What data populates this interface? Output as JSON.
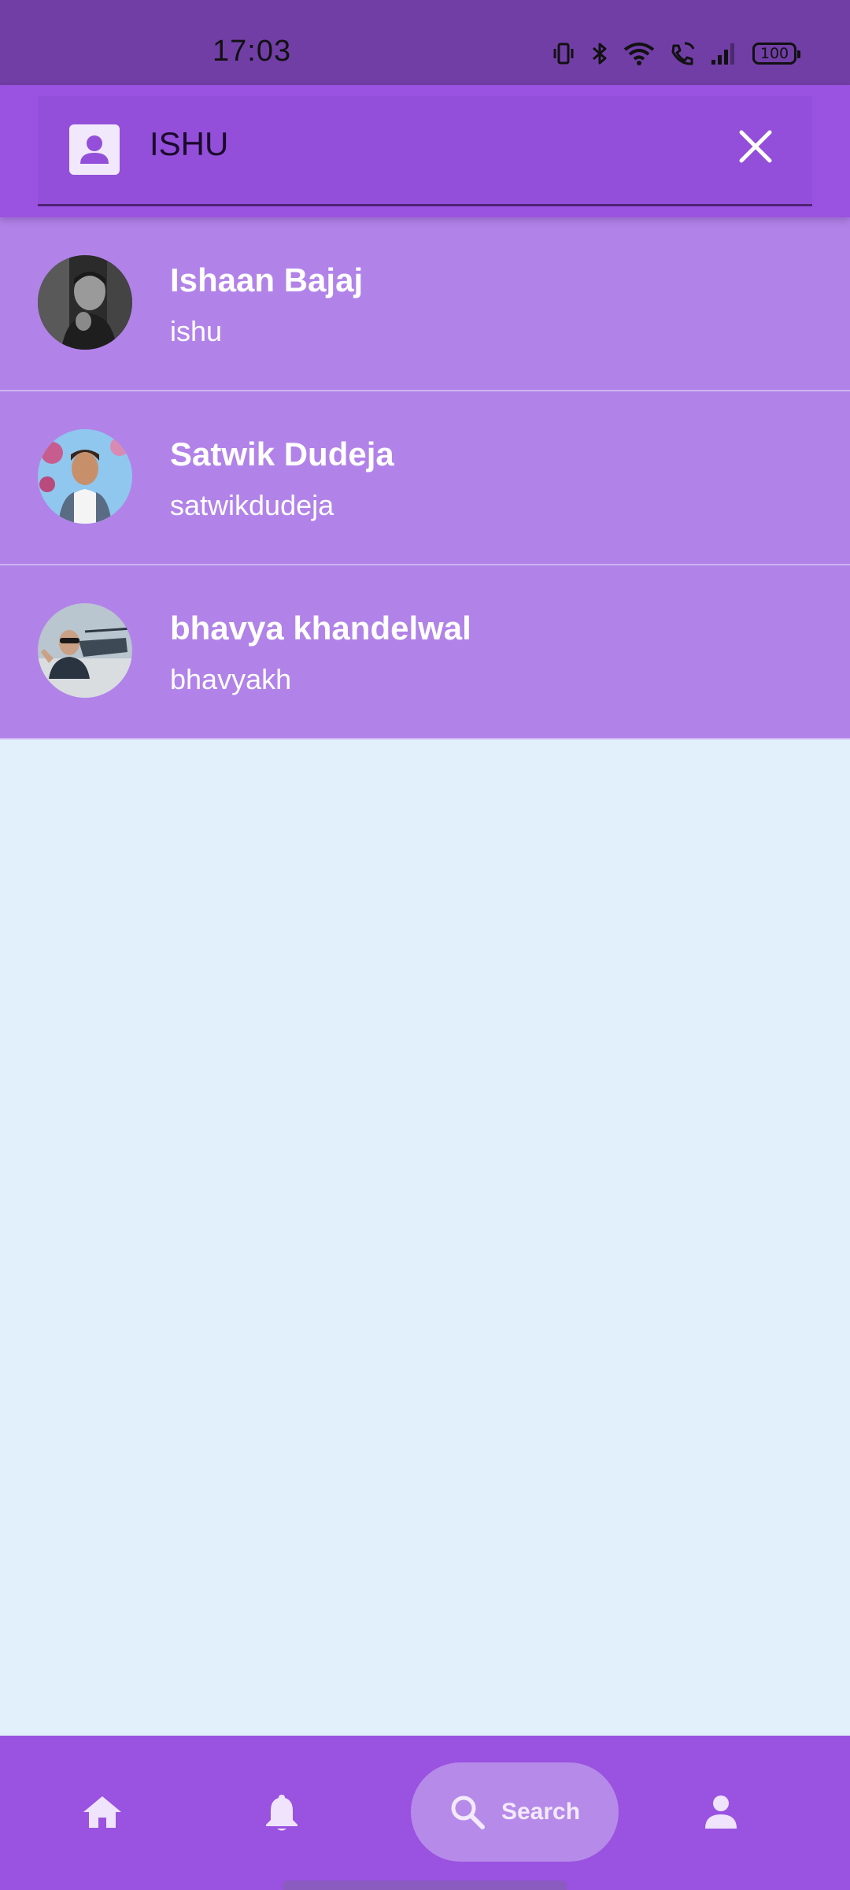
{
  "status_bar": {
    "time": "17:03",
    "battery": "100",
    "icons": [
      "vibrate-icon",
      "bluetooth-icon",
      "wifi-icon",
      "wifi-calling-icon",
      "signal-icon",
      "battery-icon"
    ]
  },
  "search": {
    "query": "ISHU",
    "leading_icon": "contact-icon",
    "clear_icon": "close-icon"
  },
  "results": [
    {
      "name": "Ishaan Bajaj",
      "username": "ishu",
      "avatar": "avatar-photo-bw"
    },
    {
      "name": "Satwik Dudeja",
      "username": "satwikdudeja",
      "avatar": "avatar-photo-color"
    },
    {
      "name": "bhavya khandelwal",
      "username": "bhavyakh",
      "avatar": "avatar-photo-helicopter"
    }
  ],
  "bottom_nav": {
    "items": [
      {
        "icon": "home-icon"
      },
      {
        "icon": "bell-icon"
      },
      {
        "icon": "search-icon",
        "label": "Search",
        "active": true
      },
      {
        "icon": "person-icon"
      }
    ]
  },
  "colors": {
    "status_bar": "#713ea6",
    "app_bar": "#9a52e0",
    "result_row": "#b183e8",
    "background": "#e2f0fb",
    "nav_active_pill": "#b68ae9"
  }
}
